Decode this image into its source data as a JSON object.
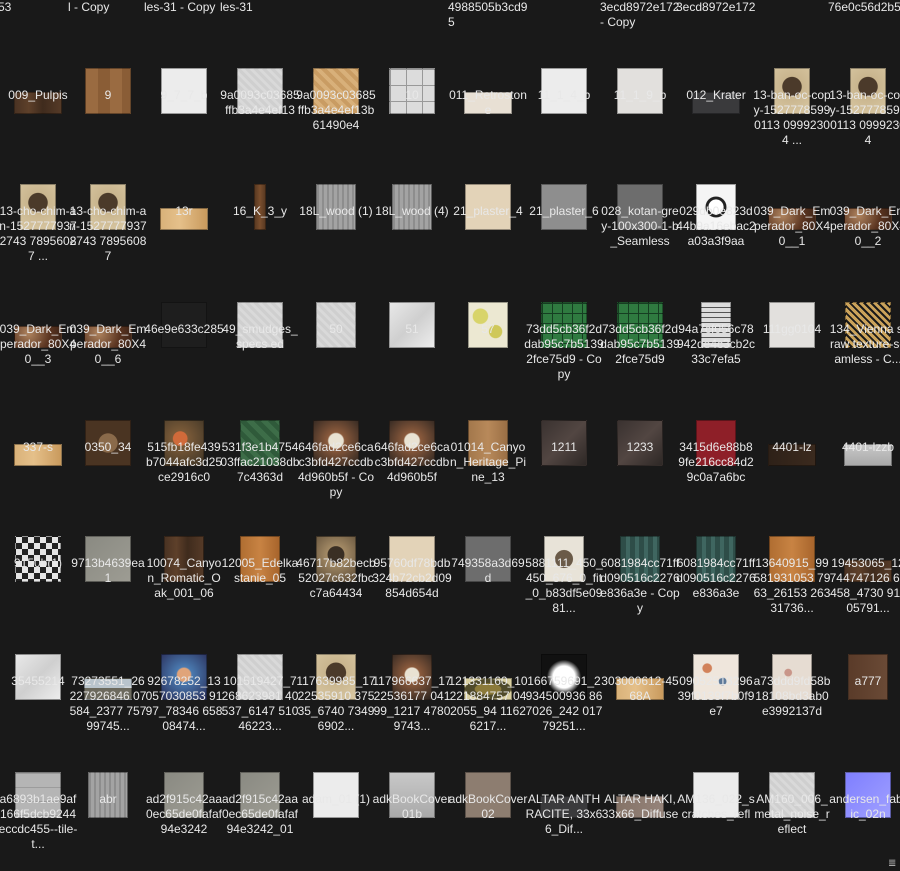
{
  "partial_labels": [
    "53",
    "l - Copy",
    "les-31 - Copy",
    "les-31",
    "",
    "",
    "4988505b3cd95",
    "",
    "3ecd8972e172 - Copy",
    "3ecd8972e172",
    "",
    "76e0c56d2b53"
  ],
  "rows": [
    [
      {
        "label": "009_Pulpis",
        "thumb": "wood-dark",
        "shape": "wide"
      },
      {
        "label": "9",
        "thumb": "parquet",
        "shape": "square"
      },
      {
        "label": "9_7_7_b",
        "thumb": "white",
        "shape": "square"
      },
      {
        "label": "9a0093c03685ffb3a4e4ef13",
        "thumb": "light-gray",
        "shape": "square"
      },
      {
        "label": "9a0093c03685ffb3a4e4ef13b61490e4",
        "thumb": "tan-weave",
        "shape": "square"
      },
      {
        "label": "10",
        "thumb": "tiles",
        "shape": "square"
      },
      {
        "label": "011_Retrostone",
        "thumb": "cream",
        "shape": "wide"
      },
      {
        "label": "11_1_4_b",
        "thumb": "white",
        "shape": "square"
      },
      {
        "label": "11_1_9_b",
        "thumb": "off-white",
        "shape": "square"
      },
      {
        "label": "012_Krater",
        "thumb": "charcoal",
        "shape": "wide"
      },
      {
        "label": "13-ban-oc-copy-15277785990113 09992304 ...",
        "thumb": "painting",
        "shape": "portrait"
      },
      {
        "label": "13-ban-oc-copy-15277785990113 09992304",
        "thumb": "painting",
        "shape": "portrait"
      }
    ],
    [
      {
        "label": "13-cho-chim-an-15277779372743 78956087 ...",
        "thumb": "painting",
        "shape": "portrait"
      },
      {
        "label": "13-cho-chim-an-15277779372743 78956087",
        "thumb": "painting",
        "shape": "portrait"
      },
      {
        "label": "13r",
        "thumb": "wood-light",
        "shape": "wide"
      },
      {
        "label": "16_K_3_y",
        "thumb": "wood-strip",
        "shape": "strip"
      },
      {
        "label": "18L_wood (1)",
        "thumb": "gray-wood",
        "shape": "tall"
      },
      {
        "label": "18L_wood (4)",
        "thumb": "gray-wood",
        "shape": "tall"
      },
      {
        "label": "21_plaster_4",
        "thumb": "beige",
        "shape": "square"
      },
      {
        "label": "21_plaster_6",
        "thumb": "gray",
        "shape": "square"
      },
      {
        "label": "028_kotan-grey-100x300-1-b_Seamless",
        "thumb": "dark-gray",
        "shape": "square"
      },
      {
        "label": "029db0e823d44b9a16ebac2a03a3f9aa",
        "thumb": "abstract",
        "shape": "tall"
      },
      {
        "label": "039_Dark_Emperador_80X40__1",
        "thumb": "marble-brown",
        "shape": "wide"
      },
      {
        "label": "039_Dark_Emperador_80X40__2",
        "thumb": "marble-brown",
        "shape": "wide"
      }
    ],
    [
      {
        "label": "039_Dark_Emperador_80X40__3",
        "thumb": "marble-brown",
        "shape": "wide"
      },
      {
        "label": "039_Dark_Emperador_80X40__6",
        "thumb": "marble-brown",
        "shape": "wide"
      },
      {
        "label": "46e9e633c285",
        "thumb": "near-black",
        "shape": "square"
      },
      {
        "label": "49_smudges_specs ed",
        "thumb": "light-gray",
        "shape": "square"
      },
      {
        "label": "50",
        "thumb": "light-gray",
        "shape": "tall"
      },
      {
        "label": "51",
        "thumb": "marble-white",
        "shape": "square"
      },
      {
        "label": "57",
        "thumb": "lemons",
        "shape": "tall"
      },
      {
        "label": "73dd5cb36f2ddab95c7b51392fce75d9 - Copy",
        "thumb": "green-tile",
        "shape": "square"
      },
      {
        "label": "73dd5cb36f2ddab95c7b51392fce75d9",
        "thumb": "green-tile",
        "shape": "square"
      },
      {
        "label": "94a7cf056c78942de4c3cb2c33c7efa5",
        "thumb": "ornament",
        "shape": "narrow"
      },
      {
        "label": "111gg0104",
        "thumb": "off-white",
        "shape": "square"
      },
      {
        "label": "134_Vienna straw texture-seamless - C...",
        "thumb": "rattan",
        "shape": "square"
      }
    ],
    [
      {
        "label": "337-s",
        "thumb": "wood-light",
        "shape": "wide"
      },
      {
        "label": "0350_34",
        "thumb": "brown-pattern",
        "shape": "square"
      },
      {
        "label": "515fb18fe439b7044afc3d25ce2916c0",
        "thumb": "flowers",
        "shape": "tall"
      },
      {
        "label": "531f3e1b475403ffac21038db7c4363d",
        "thumb": "herringbone",
        "shape": "tall"
      },
      {
        "label": "646fad2ce6cac3bfd427ccdb4d960b5f - Copy",
        "thumb": "painting-dark",
        "shape": "square"
      },
      {
        "label": "646fad2ce6cac3bfd427ccdb4d960b5f",
        "thumb": "painting-dark",
        "shape": "square"
      },
      {
        "label": "01014_Canyon_Heritage_Pine_13",
        "thumb": "wood-med",
        "shape": "tall"
      },
      {
        "label": "1211",
        "thumb": "dark-marble",
        "shape": "square"
      },
      {
        "label": "1233",
        "thumb": "dark-marble",
        "shape": "square"
      },
      {
        "label": "3415d6e88b89fe216cc84d29c0a7a6bc",
        "thumb": "red",
        "shape": "tall"
      },
      {
        "label": "4401-lz",
        "thumb": "dark-wood",
        "shape": "wide"
      },
      {
        "label": "4401-lzzb",
        "thumb": "silver",
        "shape": "wide"
      }
    ],
    [
      {
        "label": "9150b(1)",
        "thumb": "mosaic",
        "shape": "square"
      },
      {
        "label": "9713b4639ea1",
        "thumb": "stone-gray",
        "shape": "square"
      },
      {
        "label": "10074_Canyon_Romatic_Oak_001_06",
        "thumb": "wood-dark",
        "shape": "tall"
      },
      {
        "label": "12005_Edelkastanie_05",
        "thumb": "wood-orange",
        "shape": "tall"
      },
      {
        "label": "46717b82becb52027c632fbcc7a64434",
        "thumb": "portrait-frame",
        "shape": "tall"
      },
      {
        "label": "95760df78bdb324b72cb2d09854d654d",
        "thumb": "beige",
        "shape": "square"
      },
      {
        "label": "749358a3d69d",
        "thumb": "dark-gray",
        "shape": "square"
      },
      {
        "label": "5881111_450_450_676_0_fit_0_b83df5e0981...",
        "thumb": "figures",
        "shape": "tall"
      },
      {
        "label": "6081984cc71ffd090516c2276e836a3e - Copy",
        "thumb": "teal-panel",
        "shape": "tall"
      },
      {
        "label": "6081984cc71ffd090516c2276e836a3e",
        "thumb": "teal-panel",
        "shape": "tall"
      },
      {
        "label": "13640915_99581931053 7963_26153 26331736...",
        "thumb": "wood-orange",
        "shape": "square"
      },
      {
        "label": "19453065_12744747126 65458_4730 91105791...",
        "thumb": "wood-dark",
        "shape": "wide"
      }
    ],
    [
      {
        "label": "35455214",
        "thumb": "marble-white",
        "shape": "square"
      },
      {
        "label": "73273551_26227926846 07584_2377 75799745...",
        "thumb": "cityscape",
        "shape": "wide"
      },
      {
        "label": "92678252_13057030853 9197_78346 65808474...",
        "thumb": "colorful-art",
        "shape": "square"
      },
      {
        "label": "101519427_7268623981 40537_6147 51046223...",
        "thumb": "light-gray",
        "shape": "square"
      },
      {
        "label": "117639985_1722535910 37535_6740 73496902...",
        "thumb": "painting",
        "shape": "tall"
      },
      {
        "label": "117966637_1722536177 04199_1217 47809743...",
        "thumb": "painting-dark",
        "shape": "tall"
      },
      {
        "label": "121331160_10221884757 042055_94 11626217...",
        "thumb": "landscape",
        "shape": "wide"
      },
      {
        "label": "166759691_2934500936 867026_242 01779251...",
        "thumb": "leaf",
        "shape": "square"
      },
      {
        "label": "303000612-4568A",
        "thumb": "wood-light",
        "shape": "wide"
      },
      {
        "label": "0905251829639f0139f7b0f9e7",
        "thumb": "floral",
        "shape": "square"
      },
      {
        "label": "a73ddd9fd58b18108bd3ab0e3992137d",
        "thumb": "floral-pale",
        "shape": "tall"
      },
      {
        "label": "a777",
        "thumb": "brown",
        "shape": "tall"
      }
    ],
    [
      {
        "label": "a6893b1ae9af166f5dcb9244eccdc455--tile-t...",
        "thumb": "tiles-gray",
        "shape": "square"
      },
      {
        "label": "abr",
        "thumb": "gray-wood",
        "shape": "tall"
      },
      {
        "label": "ad2f915c42aa0ec65de0fafaf94e3242",
        "thumb": "stone-gray",
        "shape": "tall"
      },
      {
        "label": "ad2f915c42aa0ec65de0fafaf94e3242_01",
        "thumb": "stone-gray",
        "shape": "tall"
      },
      {
        "label": "adam_01 (1)",
        "thumb": "white",
        "shape": "square"
      },
      {
        "label": "adkBookCover01b",
        "thumb": "silver",
        "shape": "square"
      },
      {
        "label": "adkBookCover02",
        "thumb": "brown-gray",
        "shape": "square"
      },
      {
        "label": "ALTAR ANTHRACITE, 33x66_Dif...",
        "thumb": "charcoal",
        "shape": "wide"
      },
      {
        "label": "ALTAR HAKI, 33x66_Diffuse",
        "thumb": "gray-brown",
        "shape": "wide"
      },
      {
        "label": "AM136_022_scratches_refl",
        "thumb": "white",
        "shape": "square"
      },
      {
        "label": "AM160_006_metal_noise_reflect",
        "thumb": "light-gray",
        "shape": "square"
      },
      {
        "label": "andersen_fabric_02n",
        "thumb": "normal-map",
        "shape": "square"
      }
    ]
  ],
  "colors": {
    "background": "#191919",
    "text": "#e8e8e8"
  },
  "scroll_grip_icon": "≣"
}
